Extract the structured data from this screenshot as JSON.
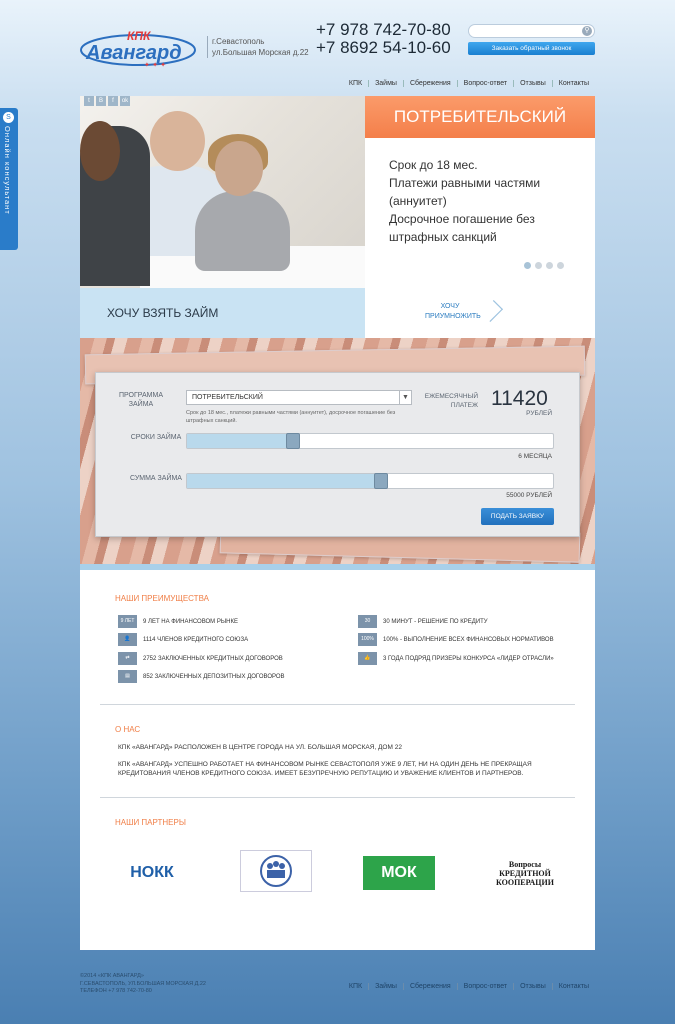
{
  "header": {
    "logo_top": "КПК",
    "logo_main": "Авангард",
    "city": "г.Севастополь",
    "street": "ул.Большая Морская д.22",
    "phone1": "+7 978 742-70-80",
    "phone2": "+7 8692 54-10-60",
    "callback_label": "Заказать обратный звонок"
  },
  "nav": [
    "КПК",
    "Займы",
    "Сбережения",
    "Вопрос-ответ",
    "Отзывы",
    "Контакты"
  ],
  "side_tab": "Онлайн консультант",
  "social": [
    "t",
    "В",
    "f",
    "ok"
  ],
  "hero": {
    "product": "ПОТРЕБИТЕЛЬСКИЙ",
    "desc": [
      "Срок до 18 мес.",
      "Платежи равными частями",
      "(аннуитет)",
      "Досрочное погашение без",
      "штрафных санкций"
    ],
    "loan_cta": "ХОЧУ ВЗЯТЬ ЗАЙМ",
    "invest_cta": "ХОЧУ ПРИУМНОЖИТЬ"
  },
  "calc": {
    "program_label": "ПРОГРАММА ЗАЙМА",
    "program_value": "ПОТРЕБИТЕЛЬСКИЙ",
    "program_desc": "Срок до 18 мес., платежи равными частями (аннуитет), досрочное погашение без штрафных санкций.",
    "monthly_label": "ЕЖЕМЕСЯЧНЫЙ ПЛАТЕЖ",
    "monthly_value": "11420",
    "currency": "РУБЛЕЙ",
    "term_label": "СРОКИ ЗАЙМА",
    "term_value": "6 МЕСЯЦА",
    "term_fraction": 0.29,
    "sum_label": "СУММА ЗАЙМА",
    "sum_value": "55000 РУБЛЕЙ",
    "sum_fraction": 0.53,
    "apply_label": "ПОДАТЬ ЗАЯВКУ"
  },
  "advantages": {
    "title": "НАШИ ПРЕИМУЩЕСТВА",
    "left": [
      {
        "icon": "9 ЛЕТ",
        "text": "9 ЛЕТ НА ФИНАНСОВОМ РЫНКЕ"
      },
      {
        "icon": "",
        "text": "1114 ЧЛЕНОВ КРЕДИТНОГО СОЮЗА"
      },
      {
        "icon": "",
        "text": "2752 ЗАКЛЮЧЕННЫХ КРЕДИТНЫХ ДОГОВОРОВ"
      },
      {
        "icon": "",
        "text": "852 ЗАКЛЮЧЕННЫХ ДЕПОЗИТНЫХ ДОГОВОРОВ"
      }
    ],
    "right": [
      {
        "icon": "30",
        "text": "30 МИНУТ - РЕШЕНИЕ ПО КРЕДИТУ"
      },
      {
        "icon": "100%",
        "text": "100% - ВЫПОЛНЕНИЕ ВСЕХ ФИНАНСОВЫХ НОРМАТИВОВ"
      },
      {
        "icon": "",
        "text": "3 ГОДА ПОДРЯД ПРИЗЕРЫ КОНКУРСА «ЛИДЕР ОТРАСЛИ»"
      }
    ]
  },
  "about": {
    "title": "О НАС",
    "line1": "КПК «АВАНГАРД» РАСПОЛОЖЕН В ЦЕНТРЕ ГОРОДА НА УЛ. БОЛЬШАЯ МОРСКАЯ, ДОМ 22",
    "line2": "КПК «АВАНГАРД» УСПЕШНО РАБОТАЕТ НА ФИНАНСОВОМ РЫНКЕ СЕВАСТОПОЛЯ УЖЕ 9 ЛЕТ, НИ НА ОДИН ДЕНЬ НЕ ПРЕКРАЩАЯ",
    "line3": "КРЕДИТОВАНИЯ ЧЛЕНОВ КРЕДИТНОГО СОЮЗА. ИМЕЕТ БЕЗУПРЕЧНУЮ РЕПУТАЦИЮ И УВАЖЕНИЕ КЛИЕНТОВ И ПАРТНЕРОВ."
  },
  "partners": {
    "title": "НАШИ ПАРТНЕРЫ",
    "items": [
      "НОКК",
      "",
      "МОК",
      "Вопросы КРЕДИТНОЙ КООПЕРАЦИИ"
    ]
  },
  "footer": {
    "copy1": "©2014 «КПК АВАНГАРД»",
    "copy2": "Г.СЕВАСТОПОЛЬ, УЛ.БОЛЬШАЯ МОРСКАЯ Д.22",
    "copy3": "ТЕЛЕФОН +7 978 742-70-80",
    "nav": [
      "КПК",
      "Займы",
      "Сбережения",
      "Вопрос-ответ",
      "Отзывы",
      "Контакты"
    ]
  },
  "colors": {
    "accent": "#f47f4a",
    "brand_blue": "#1a7fd0",
    "light_blue": "#c9e3f3"
  }
}
